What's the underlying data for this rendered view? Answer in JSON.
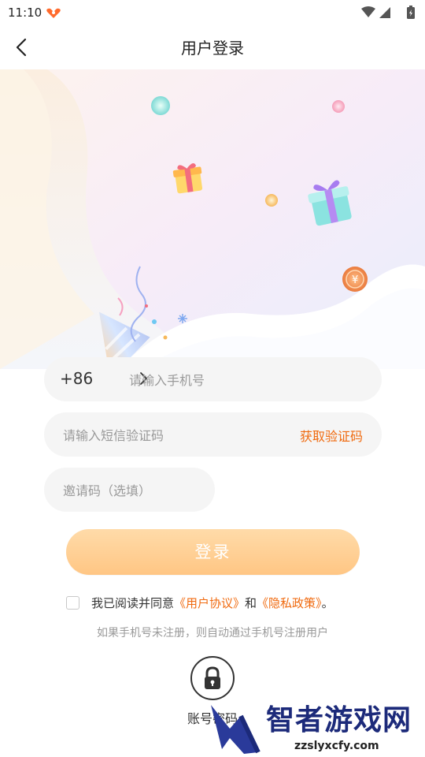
{
  "status_bar": {
    "time": "11:10"
  },
  "nav": {
    "title": "用户登录"
  },
  "form": {
    "country_code": "+86",
    "phone_placeholder": "请输入手机号",
    "code_placeholder": "请输入短信验证码",
    "get_code_label": "获取验证码",
    "invite_placeholder": "邀请码（选填）",
    "login_label": "登录"
  },
  "agreement": {
    "prefix": "我已阅读并同意",
    "user_agreement": "《用户协议》",
    "and": "和",
    "privacy_policy": "《隐私政策》",
    "suffix": "。"
  },
  "hint": "如果手机号未注册，则自动通过手机号注册用户",
  "alt_login": {
    "label": "账号密码"
  },
  "watermark": {
    "title": "智者游戏网",
    "url": "zzslyxcfy.com"
  },
  "colors": {
    "accent": "#f06a0f",
    "button": "#ffc684",
    "field_bg": "#f5f5f5"
  }
}
